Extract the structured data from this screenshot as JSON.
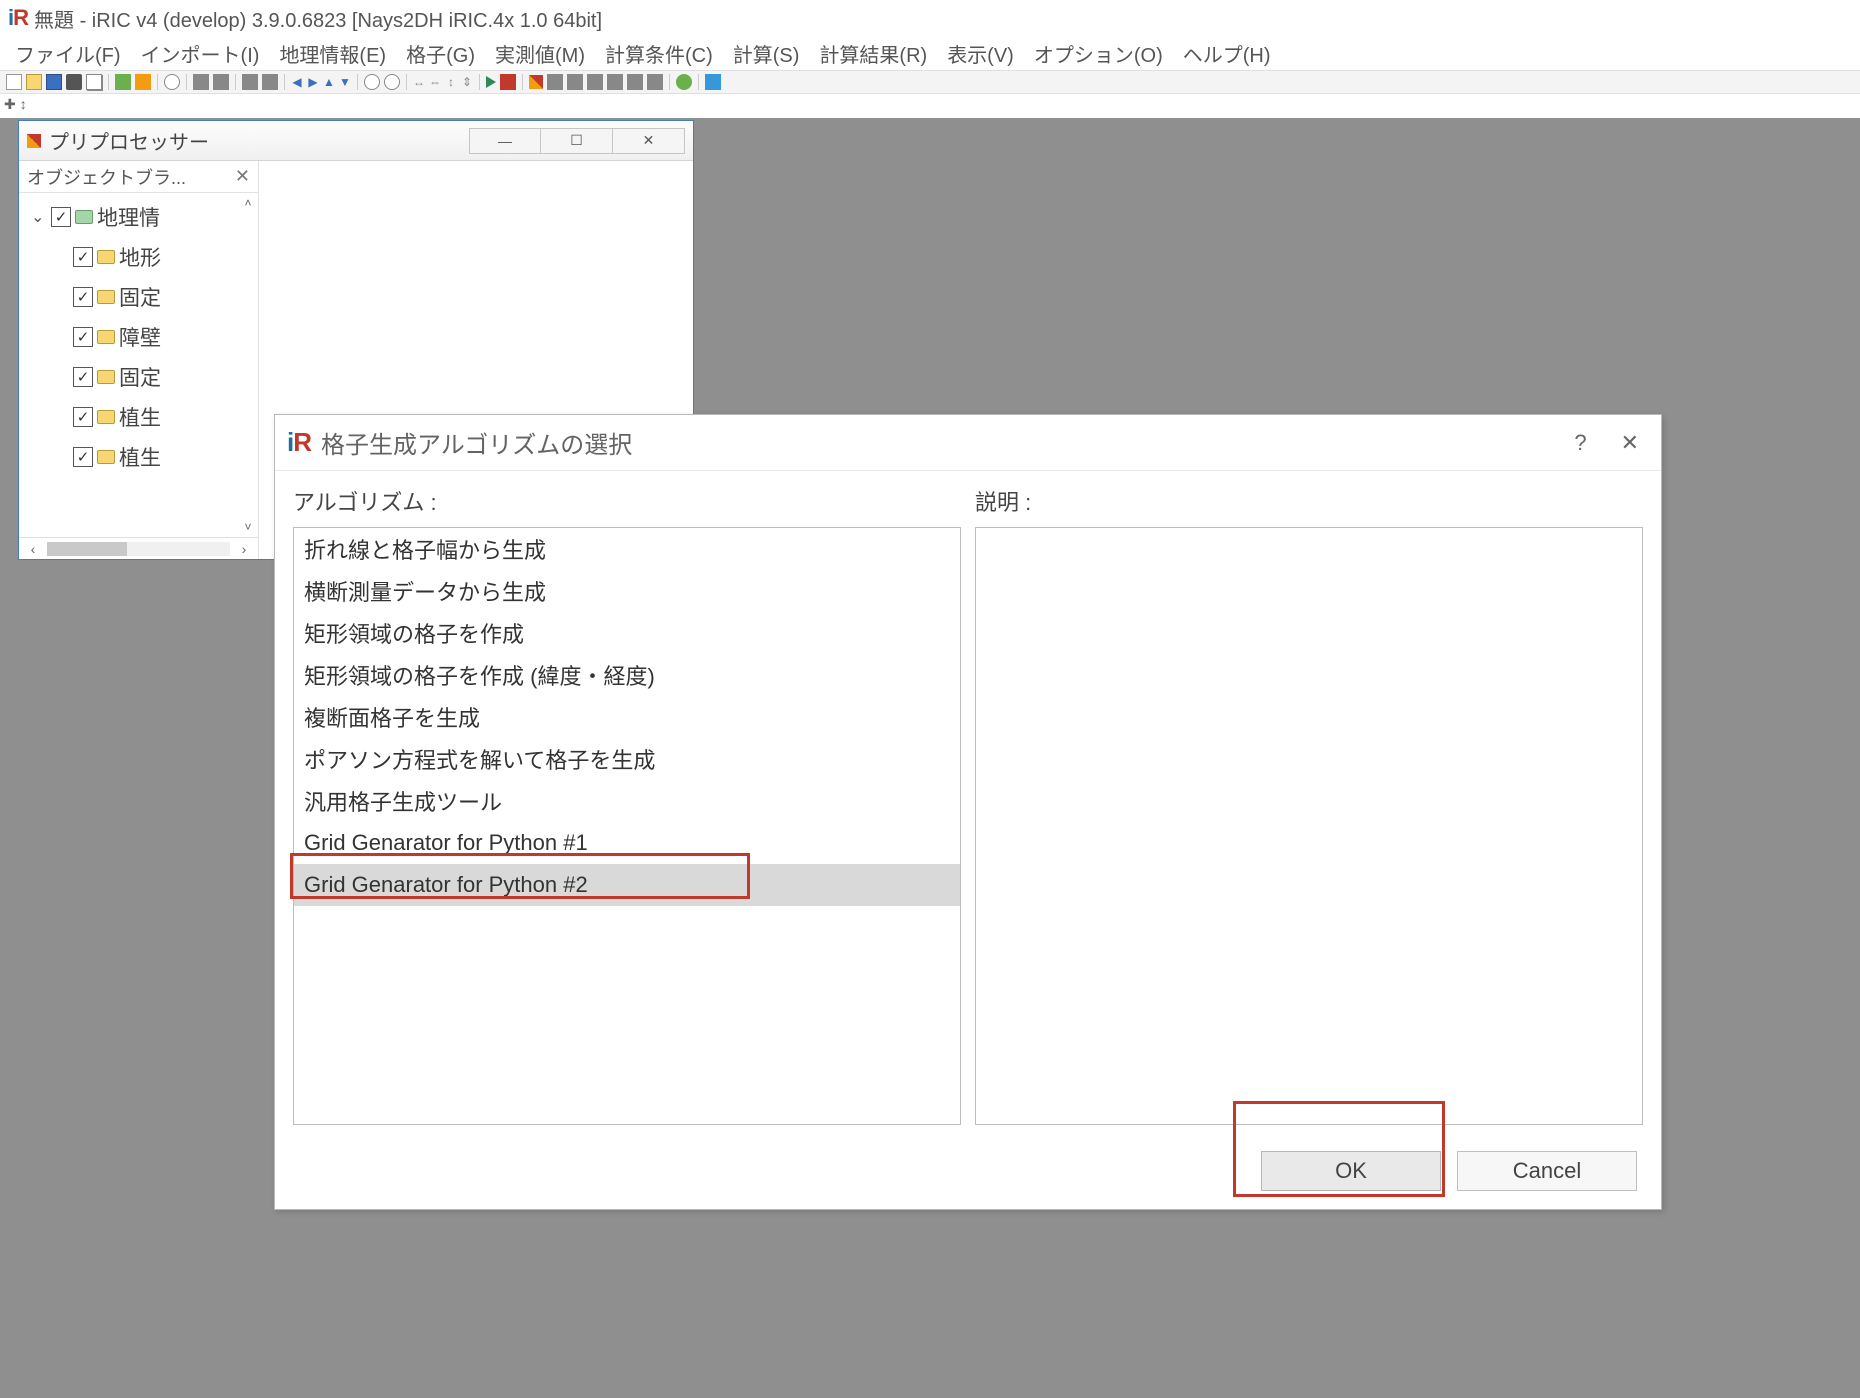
{
  "title": "無題 - iRIC v4 (develop) 3.9.0.6823 [Nays2DH iRIC.4x 1.0 64bit]",
  "menu": {
    "file": "ファイル(F)",
    "import": "インポート(I)",
    "geo": "地理情報(E)",
    "grid": "格子(G)",
    "measured": "実測値(M)",
    "calc_cond": "計算条件(C)",
    "calc": "計算(S)",
    "result": "計算結果(R)",
    "view": "表示(V)",
    "option": "オプション(O)",
    "help": "ヘルプ(H)"
  },
  "preprocessor": {
    "title": "プリプロセッサー",
    "object_tab": "オブジェクトブラ...",
    "tree": {
      "root": "地理情",
      "items": [
        "地形",
        "固定",
        "障壁",
        "固定",
        "植生",
        "植生"
      ]
    }
  },
  "dialog": {
    "title": "格子生成アルゴリズムの選択",
    "algo_label": "アルゴリズム :",
    "desc_label": "説明 :",
    "algorithms": [
      "折れ線と格子幅から生成",
      "横断測量データから生成",
      "矩形領域の格子を作成",
      "矩形領域の格子を作成 (緯度・経度)",
      "複断面格子を生成",
      "ポアソン方程式を解いて格子を生成",
      "汎用格子生成ツール",
      "Grid Genarator for Python #1",
      "Grid Genarator for Python #2"
    ],
    "selected_index": 8,
    "ok": "OK",
    "cancel": "Cancel",
    "help": "?",
    "close": "✕"
  }
}
